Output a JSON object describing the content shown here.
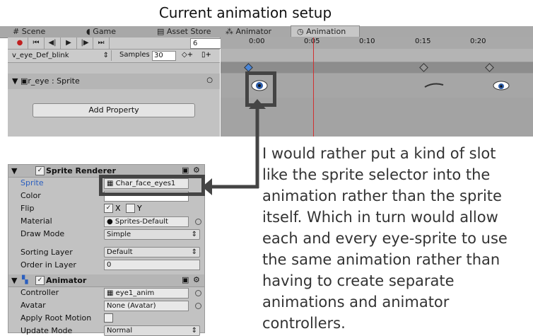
{
  "heading": "Current animation setup",
  "tabs": [
    "Scene",
    "Game",
    "Asset Store",
    "Animator",
    "Animation"
  ],
  "frame_field": "6",
  "clip": "v_eye_Def_blink",
  "samples_label": "Samples",
  "samples_value": "30",
  "ticks": [
    "0:00",
    "0:05",
    "0:10",
    "0:15",
    "0:20"
  ],
  "property": "r_eye : Sprite",
  "add_property": "Add Property",
  "sprite_renderer": {
    "title": "Sprite Renderer",
    "rows": {
      "sprite": "Sprite",
      "sprite_value": "Char_face_eyes1",
      "color": "Color",
      "flip": "Flip",
      "flip_x": "X",
      "flip_y": "Y",
      "material": "Material",
      "material_value": "Sprites-Default",
      "draw_mode": "Draw Mode",
      "draw_mode_value": "Simple",
      "sorting_layer": "Sorting Layer",
      "sorting_layer_value": "Default",
      "order_in_layer": "Order in Layer",
      "order_in_layer_value": "0"
    }
  },
  "animator": {
    "title": "Animator",
    "controller": "Controller",
    "controller_value": "eye1_anim",
    "avatar": "Avatar",
    "avatar_value": "None (Avatar)",
    "apply_root_motion": "Apply Root Motion",
    "update_mode": "Update Mode",
    "update_mode_value": "Normal"
  },
  "annotation": [
    "I would rather put a kind of slot",
    "like the sprite selector into the",
    "animation rather than the sprite",
    "itself. Which in turn would allow",
    "each and every eye-sprite to use",
    "the same animation rather than",
    "having to create separate",
    "animations and animator controllers."
  ],
  "colors": {
    "accent": "#2b5fbf",
    "playhead": "#d03030",
    "annotation_box": "#444444"
  }
}
